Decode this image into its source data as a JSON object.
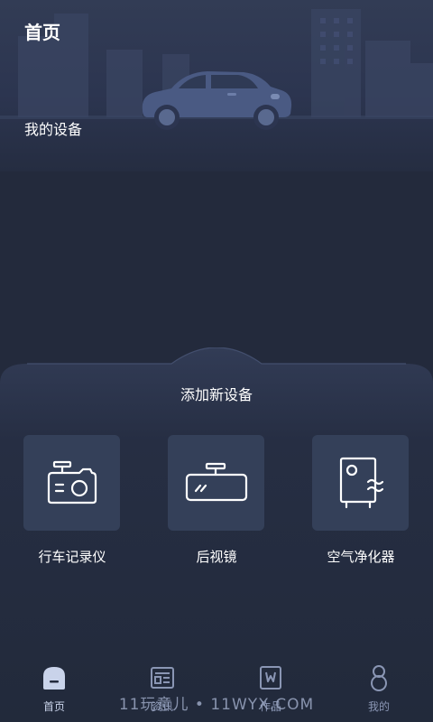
{
  "header": {
    "title": "首页",
    "my_devices": "我的设备"
  },
  "add_device": {
    "title": "添加新设备",
    "devices": [
      {
        "label": "行车记录仪",
        "icon": "dashcam-icon"
      },
      {
        "label": "后视镜",
        "icon": "rearview-mirror-icon"
      },
      {
        "label": "空气净化器",
        "icon": "air-purifier-icon"
      }
    ]
  },
  "tabbar": {
    "tabs": [
      {
        "label": "首页",
        "icon": "home-icon",
        "active": true
      },
      {
        "label": "资讯",
        "icon": "news-icon",
        "active": false
      },
      {
        "label": "作品",
        "icon": "works-icon",
        "active": false
      },
      {
        "label": "我的",
        "icon": "profile-icon",
        "active": false
      }
    ]
  },
  "watermark": "11玩意儿 • 11WYX.COM",
  "colors": {
    "background": "#232a3c",
    "tile": "#344059",
    "tab_inactive": "#8a96b4",
    "tab_active": "#c9d3ea"
  }
}
